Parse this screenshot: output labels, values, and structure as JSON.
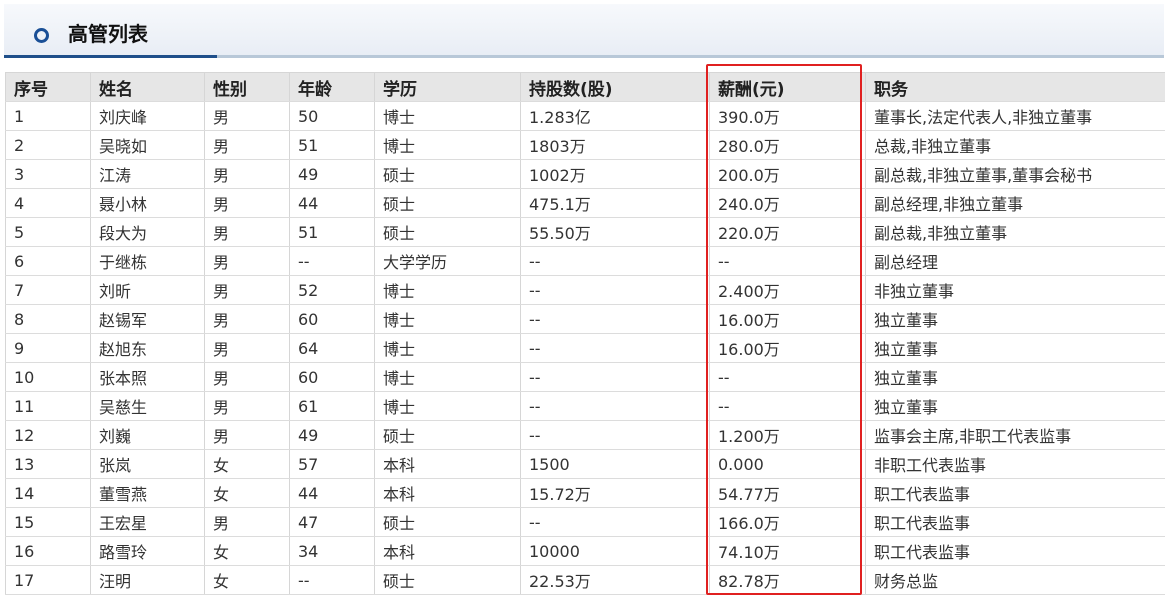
{
  "header": {
    "title": "高管列表",
    "icon": "ring-icon"
  },
  "colors": {
    "accent": "#1f4f8a",
    "highlight": "#e02020",
    "header_bg": "#e6e6e6"
  },
  "table": {
    "columns": [
      "序号",
      "姓名",
      "性别",
      "年龄",
      "学历",
      "持股数(股)",
      "薪酬(元)",
      "职务"
    ],
    "rows": [
      [
        "1",
        "刘庆峰",
        "男",
        "50",
        "博士",
        "1.283亿",
        "390.0万",
        "董事长,法定代表人,非独立董事"
      ],
      [
        "2",
        "吴晓如",
        "男",
        "51",
        "博士",
        "1803万",
        "280.0万",
        "总裁,非独立董事"
      ],
      [
        "3",
        "江涛",
        "男",
        "49",
        "硕士",
        "1002万",
        "200.0万",
        "副总裁,非独立董事,董事会秘书"
      ],
      [
        "4",
        "聂小林",
        "男",
        "44",
        "硕士",
        "475.1万",
        "240.0万",
        "副总经理,非独立董事"
      ],
      [
        "5",
        "段大为",
        "男",
        "51",
        "硕士",
        "55.50万",
        "220.0万",
        "副总裁,非独立董事"
      ],
      [
        "6",
        "于继栋",
        "男",
        "--",
        "大学学历",
        "--",
        "--",
        "副总经理"
      ],
      [
        "7",
        "刘昕",
        "男",
        "52",
        "博士",
        "--",
        "2.400万",
        "非独立董事"
      ],
      [
        "8",
        "赵锡军",
        "男",
        "60",
        "博士",
        "--",
        "16.00万",
        "独立董事"
      ],
      [
        "9",
        "赵旭东",
        "男",
        "64",
        "博士",
        "--",
        "16.00万",
        "独立董事"
      ],
      [
        "10",
        "张本照",
        "男",
        "60",
        "博士",
        "--",
        "--",
        "独立董事"
      ],
      [
        "11",
        "吴慈生",
        "男",
        "61",
        "博士",
        "--",
        "--",
        "独立董事"
      ],
      [
        "12",
        "刘巍",
        "男",
        "49",
        "硕士",
        "--",
        "1.200万",
        "监事会主席,非职工代表监事"
      ],
      [
        "13",
        "张岚",
        "女",
        "57",
        "本科",
        "1500",
        "0.000",
        "非职工代表监事"
      ],
      [
        "14",
        "董雪燕",
        "女",
        "44",
        "本科",
        "15.72万",
        "54.77万",
        "职工代表监事"
      ],
      [
        "15",
        "王宏星",
        "男",
        "47",
        "硕士",
        "--",
        "166.0万",
        "职工代表监事"
      ],
      [
        "16",
        "路雪玲",
        "女",
        "34",
        "本科",
        "10000",
        "74.10万",
        "职工代表监事"
      ],
      [
        "17",
        "汪明",
        "女",
        "--",
        "硕士",
        "22.53万",
        "82.78万",
        "财务总监"
      ]
    ]
  }
}
